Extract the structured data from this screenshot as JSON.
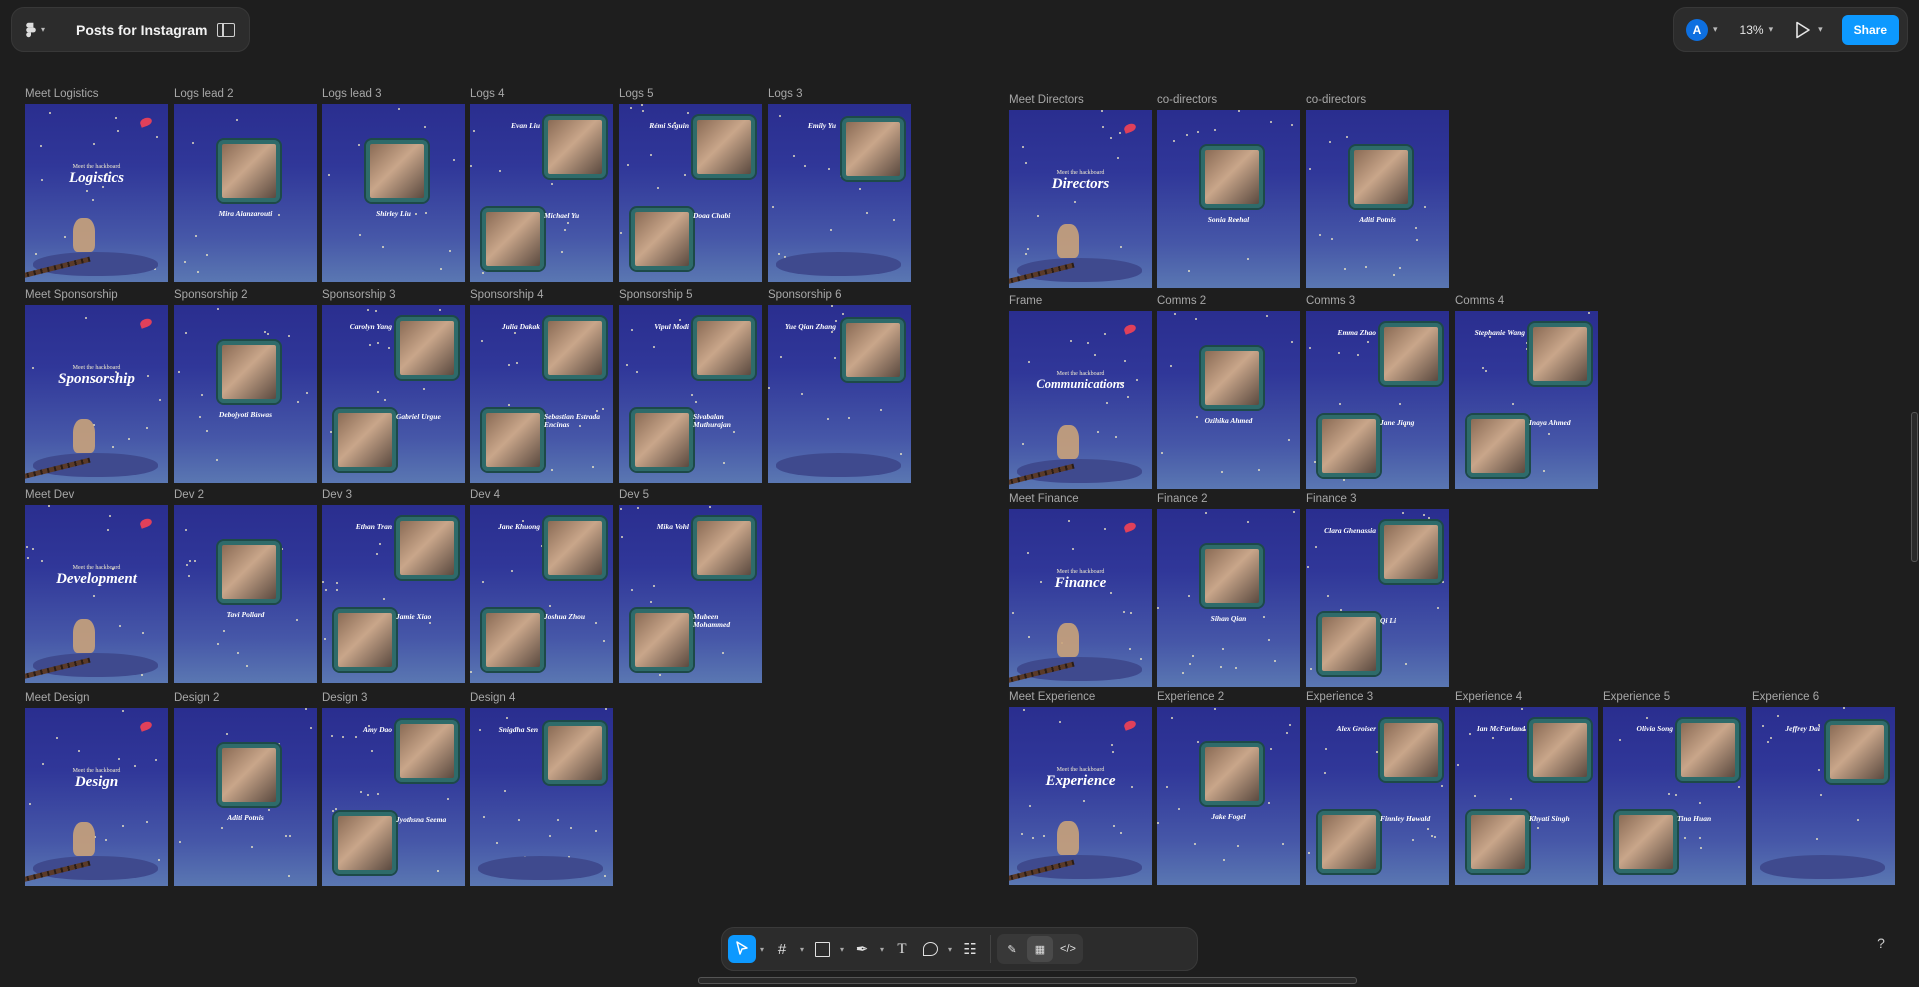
{
  "file": {
    "title": "Posts for Instagram"
  },
  "header": {
    "avatar_letter": "A",
    "zoom": "13%",
    "share_label": "Share"
  },
  "help_label": "?",
  "colors": {
    "canvas": "#1e1e1e",
    "accent": "#0d99ff",
    "frame_top": "#2a2e8f",
    "frame_bottom": "#5a77b2"
  },
  "frames": [
    {
      "label": "Meet Logistics",
      "kind": "cover",
      "heading": "Meet the hackboard",
      "big": "Logistics"
    },
    {
      "label": "Logs lead 2",
      "kind": "one",
      "people": [
        {
          "name": "Mira Alanzarouti"
        }
      ]
    },
    {
      "label": "Logs lead 3",
      "kind": "one",
      "people": [
        {
          "name": "Shirley Liu"
        }
      ]
    },
    {
      "label": "Logs 4",
      "kind": "two",
      "people": [
        {
          "name": "Evan Liu"
        },
        {
          "name": "Michael Yu"
        }
      ]
    },
    {
      "label": "Logs 5",
      "kind": "two",
      "people": [
        {
          "name": "Rémi Séguin"
        },
        {
          "name": "Doaa Chabi"
        }
      ]
    },
    {
      "label": "Logs 3",
      "kind": "one-top",
      "people": [
        {
          "name": "Emily Yu"
        }
      ]
    },
    {
      "label": "Meet Sponsorship",
      "kind": "cover",
      "heading": "Meet the hackboard",
      "big": "Sponsorship"
    },
    {
      "label": "Sponsorship 2",
      "kind": "one",
      "people": [
        {
          "name": "Debojyoti Biswas"
        }
      ]
    },
    {
      "label": "Sponsorship 3",
      "kind": "two",
      "people": [
        {
          "name": "Carolyn Yang"
        },
        {
          "name": "Gabriel Urgue"
        }
      ]
    },
    {
      "label": "Sponsorship 4",
      "kind": "two",
      "people": [
        {
          "name": "Julia Dakak"
        },
        {
          "name": "Sebastian Estrada Encinas"
        }
      ]
    },
    {
      "label": "Sponsorship 5",
      "kind": "two",
      "people": [
        {
          "name": "Vipul Modi"
        },
        {
          "name": "Sivabalan Muthurajan"
        }
      ]
    },
    {
      "label": "Sponsorship 6",
      "kind": "one-top",
      "people": [
        {
          "name": "Yue Qian Zhang"
        }
      ]
    },
    {
      "label": "Meet Dev",
      "kind": "cover",
      "heading": "Meet the hackboard",
      "big": "Development"
    },
    {
      "label": "Dev 2",
      "kind": "one",
      "people": [
        {
          "name": "Tavi Pollard"
        }
      ]
    },
    {
      "label": "Dev 3",
      "kind": "two",
      "people": [
        {
          "name": "Ethan Tran"
        },
        {
          "name": "Jamie Xiao"
        }
      ]
    },
    {
      "label": "Dev 4",
      "kind": "two",
      "people": [
        {
          "name": "Jane Khuong"
        },
        {
          "name": "Joshua Zhou"
        }
      ]
    },
    {
      "label": "Dev 5",
      "kind": "two",
      "people": [
        {
          "name": "Mika Vohl"
        },
        {
          "name": "Mubeen Mohammed"
        }
      ]
    },
    {
      "label": "Meet Design",
      "kind": "cover",
      "heading": "Meet the hackboard",
      "big": "Design"
    },
    {
      "label": "Design 2",
      "kind": "one",
      "people": [
        {
          "name": "Aditi Potnis"
        }
      ]
    },
    {
      "label": "Design 3",
      "kind": "two",
      "people": [
        {
          "name": "Amy Dao"
        },
        {
          "name": "Jyothsna Seema"
        }
      ]
    },
    {
      "label": "Design 4",
      "kind": "one-top",
      "people": [
        {
          "name": "Snigdha Sen"
        }
      ]
    },
    {
      "label": "Meet Directors",
      "kind": "cover",
      "heading": "Meet the hackboard",
      "big": "Directors"
    },
    {
      "label": "co-directors",
      "kind": "one",
      "people": [
        {
          "name": "Sonia Reehal"
        }
      ]
    },
    {
      "label": "co-directors",
      "kind": "one",
      "people": [
        {
          "name": "Aditi Potnis"
        }
      ]
    },
    {
      "label": "Frame",
      "kind": "cover",
      "heading": "Meet the hackboard",
      "big": "Communications"
    },
    {
      "label": "Comms 2",
      "kind": "one",
      "people": [
        {
          "name": "Ozihika Ahmed"
        }
      ]
    },
    {
      "label": "Comms 3",
      "kind": "two",
      "people": [
        {
          "name": "Emma Zhao"
        },
        {
          "name": "Jane Jiang"
        }
      ]
    },
    {
      "label": "Comms 4",
      "kind": "two",
      "people": [
        {
          "name": "Stephanie Wang"
        },
        {
          "name": "Inaya Ahmed"
        }
      ]
    },
    {
      "label": "Meet Finance",
      "kind": "cover",
      "heading": "Meet the hackboard",
      "big": "Finance"
    },
    {
      "label": "Finance 2",
      "kind": "one",
      "people": [
        {
          "name": "Sihan Qian"
        }
      ]
    },
    {
      "label": "Finance 3",
      "kind": "two",
      "people": [
        {
          "name": "Clara Ghenassia"
        },
        {
          "name": "Qi Li"
        }
      ]
    },
    {
      "label": "Meet Experience",
      "kind": "cover",
      "heading": "Meet the hackboard",
      "big": "Experience"
    },
    {
      "label": "Experience 2",
      "kind": "one",
      "people": [
        {
          "name": "Jake Fogel"
        }
      ]
    },
    {
      "label": "Experience 3",
      "kind": "two",
      "people": [
        {
          "name": "Alex Groiser"
        },
        {
          "name": "Finnley Howald"
        }
      ]
    },
    {
      "label": "Experience 4",
      "kind": "two",
      "people": [
        {
          "name": "Ian McFarland"
        },
        {
          "name": "Khyati Singh"
        }
      ]
    },
    {
      "label": "Experience 5",
      "kind": "two",
      "people": [
        {
          "name": "Olivia Song"
        },
        {
          "name": "Tina Huan"
        }
      ]
    },
    {
      "label": "Experience 6",
      "kind": "one-top",
      "people": [
        {
          "name": "Jeffrey Dai"
        }
      ]
    }
  ]
}
